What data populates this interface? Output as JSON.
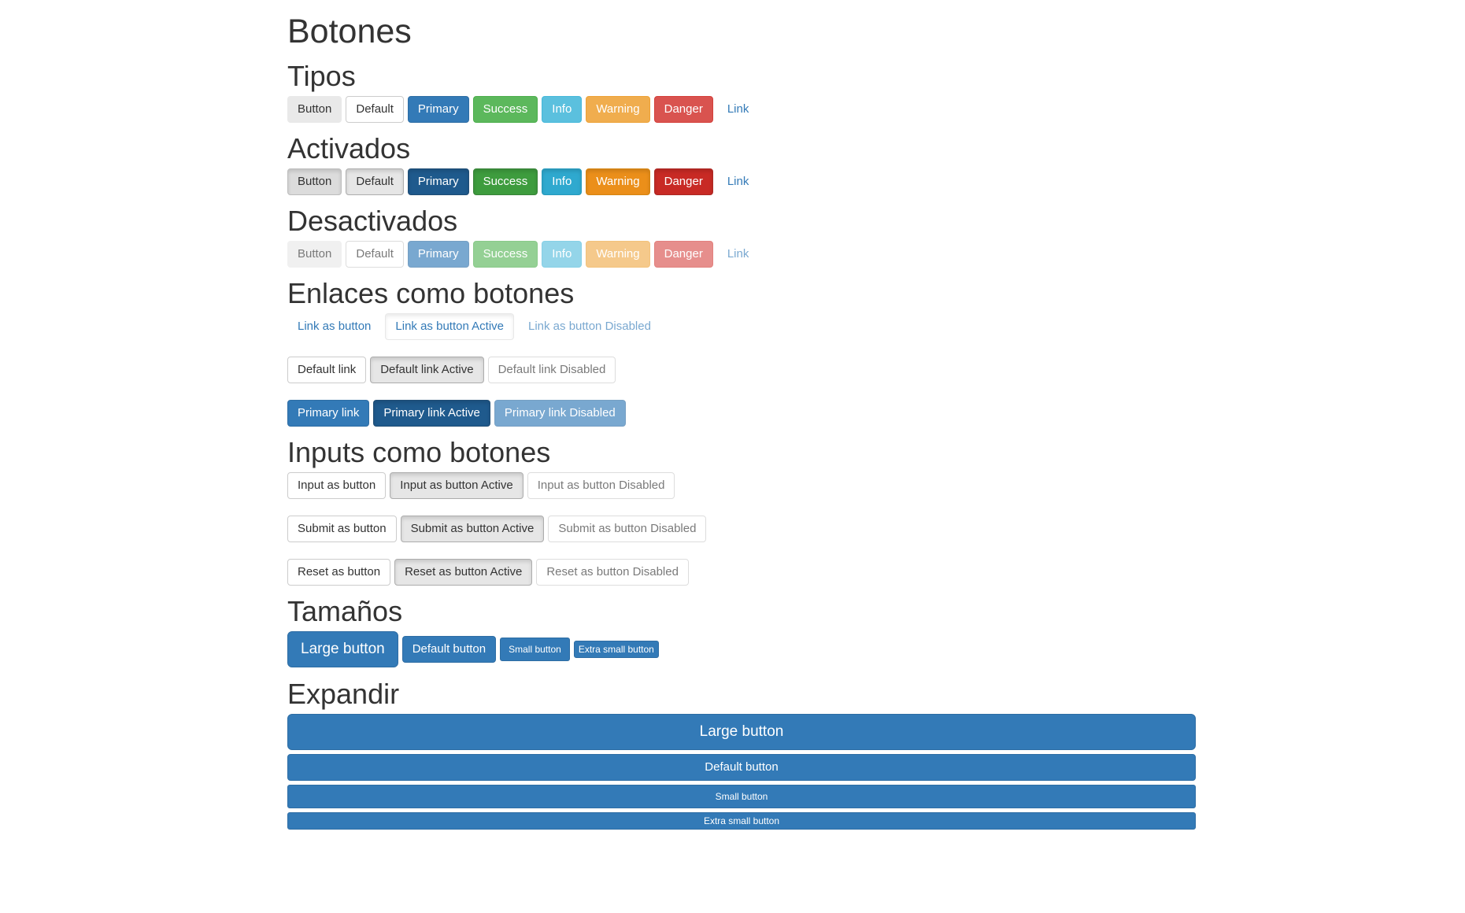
{
  "page_title": "Botones",
  "sections": {
    "tipos": {
      "title": "Tipos",
      "buttons": [
        "Button",
        "Default",
        "Primary",
        "Success",
        "Info",
        "Warning",
        "Danger",
        "Link"
      ]
    },
    "activados": {
      "title": "Activados",
      "buttons": [
        "Button",
        "Default",
        "Primary",
        "Success",
        "Info",
        "Warning",
        "Danger",
        "Link"
      ]
    },
    "desactivados": {
      "title": "Desactivados",
      "buttons": [
        "Button",
        "Default",
        "Primary",
        "Success",
        "Info",
        "Warning",
        "Danger",
        "Link"
      ]
    },
    "enlaces": {
      "title": "Enlaces como botones",
      "link_row": [
        "Link as button",
        "Link as button Active",
        "Link as button Disabled"
      ],
      "default_row": [
        "Default link",
        "Default link Active",
        "Default link Disabled"
      ],
      "primary_row": [
        "Primary link",
        "Primary link Active",
        "Primary link Disabled"
      ]
    },
    "inputs": {
      "title": "Inputs como botones",
      "input_row": [
        "Input as button",
        "Input as button Active",
        "Input as button Disabled"
      ],
      "submit_row": [
        "Submit as button",
        "Submit as button Active",
        "Submit as button Disabled"
      ],
      "reset_row": [
        "Reset as button",
        "Reset as button Active",
        "Reset as button Disabled"
      ]
    },
    "tamanos": {
      "title": "Tamaños",
      "buttons": [
        "Large button",
        "Default button",
        "Small button",
        "Extra small button"
      ]
    },
    "expandir": {
      "title": "Expandir",
      "buttons": [
        "Large button",
        "Default button",
        "Small button",
        "Extra small button"
      ]
    }
  },
  "colors": {
    "primary": "#337ab7",
    "success": "#5cb85c",
    "info": "#5bc0de",
    "warning": "#f0ad4e",
    "danger": "#d9534f",
    "link": "#337ab7",
    "text": "#333333"
  }
}
